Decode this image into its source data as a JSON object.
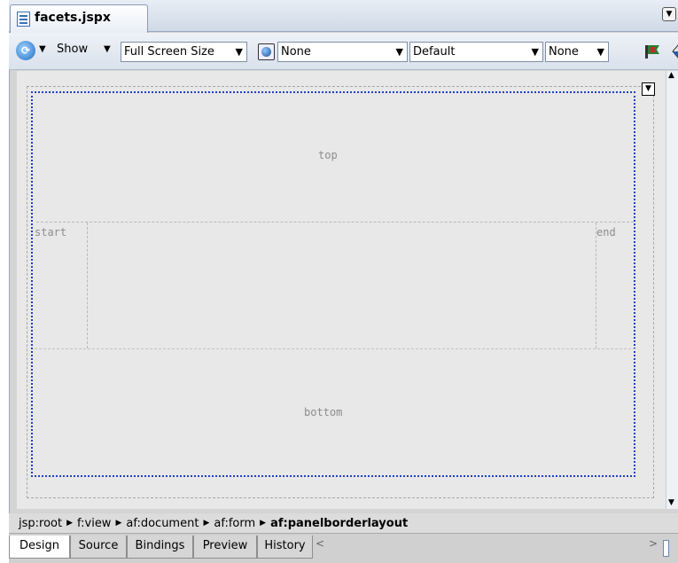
{
  "editor_tab": {
    "file_name": "facets.jspx"
  },
  "toolbar": {
    "show_label": "Show",
    "screen_size": "Full Screen Size",
    "locale": "None",
    "skin": "Default",
    "browser": "None"
  },
  "canvas": {
    "facets": {
      "top": "top",
      "start": "start",
      "end": "end",
      "bottom": "bottom"
    }
  },
  "breadcrumb": {
    "items": [
      "jsp:root",
      "f:view",
      "af:document",
      "af:form",
      "af:panelborderlayout"
    ]
  },
  "bottom_tabs": {
    "design": "Design",
    "source": "Source",
    "bindings": "Bindings",
    "preview": "Preview",
    "history": "History"
  },
  "colors": {
    "selection_border": "#1f3fc4",
    "canvas_background": "#e8e8e8"
  }
}
